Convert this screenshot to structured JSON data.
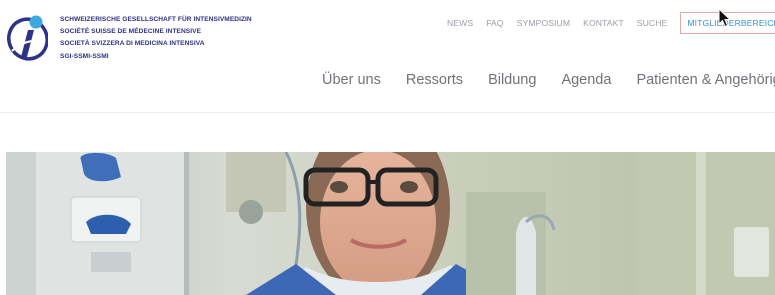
{
  "org": {
    "lines": [
      "SCHWEIZERISCHE GESELLSCHAFT FÜR INTENSIVMEDIZIN",
      "SOCIÉTÉ SUISSE DE MÉDECINE INTENSIVE",
      "SOCIETÀ SVIZZERA DI MEDICINA INTENSIVA",
      "SGI-SSMI-SSMI"
    ]
  },
  "topnav": {
    "items": [
      "NEWS",
      "FAQ",
      "SYMPOSIUM",
      "KONTAKT",
      "SUCHE"
    ],
    "member": "MITGLIEDERBEREICH"
  },
  "mainnav": {
    "items": [
      "Über uns",
      "Ressorts",
      "Bildung",
      "Agenda",
      "Patienten & Angehörige"
    ]
  },
  "colors": {
    "brand": "#2d3187",
    "accent": "#3b8fd2",
    "nav_text": "#9aa0a6",
    "member_border": "#e5a8a8"
  },
  "icons": {
    "logo": "sgi-logo-icon",
    "cursor": "mouse-cursor-icon"
  }
}
